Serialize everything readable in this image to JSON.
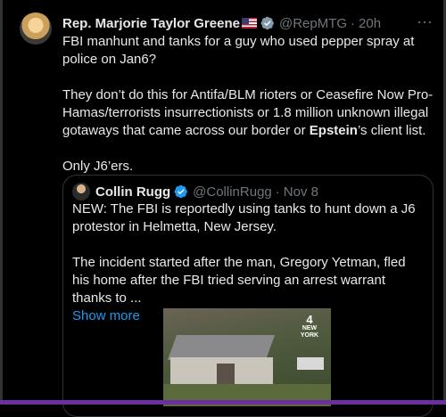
{
  "tweet": {
    "author_name": "Rep. Marjorie Taylor Greene",
    "handle": "@RepMTG",
    "separator": "·",
    "time": "20h",
    "more": "···",
    "para1": "FBI manhunt and tanks for a guy who used pepper spray at police on Jan6?",
    "para2_a": "They don’t do this for Antifa/BLM rioters or Ceasefire Now Pro-Hamas/terrorists insurrectionists or 1.8 million unknown illegal gotaways that came across our border or ",
    "para2_bold": "Epstein",
    "para2_b": "’s client list.",
    "para3": "Only J6’ers."
  },
  "quote": {
    "author_name": "Collin Rugg",
    "handle": "@CollinRugg",
    "separator": "·",
    "date": "Nov 8",
    "para1": "NEW: The FBI is reportedly using tanks to hunt down a J6 protestor in Helmetta, New Jersey.",
    "para2": "The incident started after the man, Gregory Yetman, fled his home after the FBI tried serving an arrest warrant thanks to ...",
    "show_more": "Show more",
    "media_logo_number": "4",
    "media_logo_text": "NEW YORK"
  },
  "colors": {
    "accent": "#1d9bf0",
    "muted": "#71767b",
    "text": "#e7e9ea",
    "background": "#000000"
  }
}
